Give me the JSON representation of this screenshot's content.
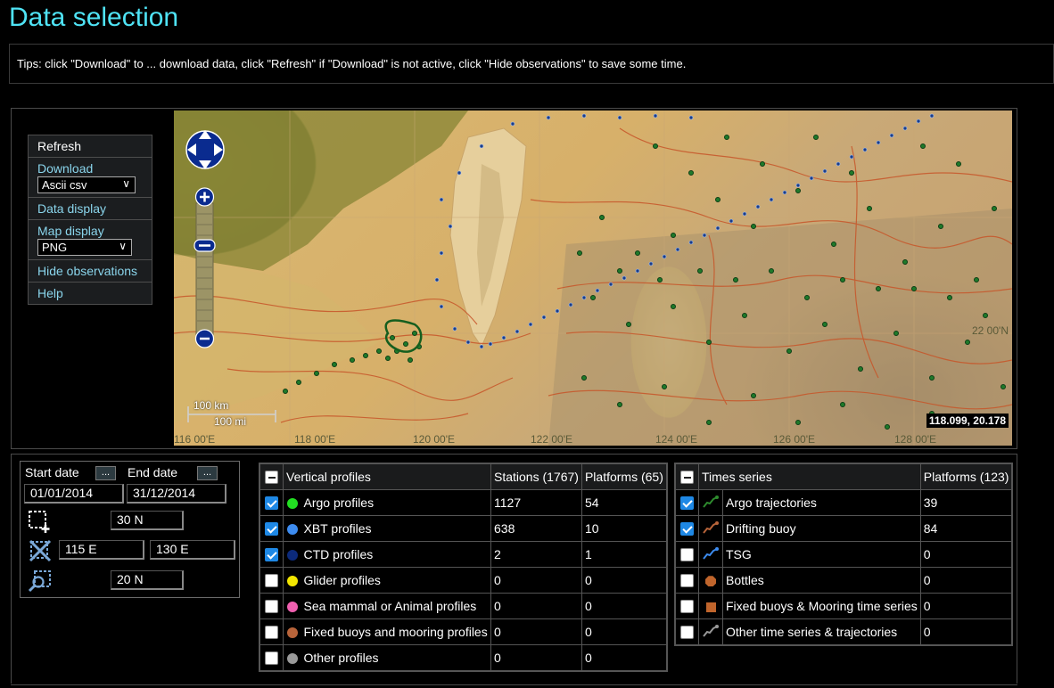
{
  "page": {
    "title": "Data selection"
  },
  "tips": {
    "text": "Tips: click \"Download\" to ... download data, click \"Refresh\" if \"Download\" is not active, click \"Hide observations\" to save some time."
  },
  "menu": {
    "refresh": "Refresh",
    "download": "Download",
    "download_format": "Ascii csv",
    "data_display": "Data display",
    "map_display": "Map display",
    "map_format": "PNG",
    "hide_observations": "Hide observations",
    "help": "Help"
  },
  "map": {
    "coordinates_readout": "118.099, 20.178",
    "scale_km": "100 km",
    "scale_mi": "100 mi",
    "lon_labels": [
      "116 00'E",
      "118 00'E",
      "120 00'E",
      "122 00'E",
      "124 00'E",
      "126 00'E",
      "128 00'E"
    ],
    "lat_label": "22 00'N"
  },
  "filters": {
    "start_date_label": "Start date",
    "end_date_label": "End date",
    "start_date": "01/01/2014",
    "end_date": "31/12/2014",
    "browse_label": "...",
    "north": "30 N",
    "west": "115 E",
    "east": "130 E",
    "south": "20 N"
  },
  "vertical_profiles": {
    "header": "Vertical profiles",
    "stations_header": "Stations (1767)",
    "platforms_header": "Platforms (65)",
    "rows": [
      {
        "label": "Argo profiles",
        "stations": "1127",
        "platforms": "54",
        "checked": true,
        "color": "#22e022"
      },
      {
        "label": "XBT profiles",
        "stations": "638",
        "platforms": "10",
        "checked": true,
        "color": "#3d8cf0"
      },
      {
        "label": "CTD profiles",
        "stations": "2",
        "platforms": "1",
        "checked": true,
        "color": "#0c2a7a"
      },
      {
        "label": "Glider profiles",
        "stations": "0",
        "platforms": "0",
        "checked": false,
        "color": "#f2e600"
      },
      {
        "label": "Sea mammal or Animal profiles",
        "stations": "0",
        "platforms": "0",
        "checked": false,
        "color": "#f060b0"
      },
      {
        "label": "Fixed buoys and mooring profiles",
        "stations": "0",
        "platforms": "0",
        "checked": false,
        "color": "#b8643a"
      },
      {
        "label": "Other profiles",
        "stations": "0",
        "platforms": "0",
        "checked": false,
        "color": "#9a9a9a"
      }
    ]
  },
  "time_series": {
    "header": "Times series",
    "platforms_header": "Platforms (123)",
    "rows": [
      {
        "label": "Argo trajectories",
        "platforms": "39",
        "checked": true,
        "color": "#2e8b2e"
      },
      {
        "label": "Drifting buoy",
        "platforms": "84",
        "checked": true,
        "color": "#b8643a"
      },
      {
        "label": "TSG",
        "platforms": "0",
        "checked": false,
        "color": "#3d8cf0"
      },
      {
        "label": "Bottles",
        "platforms": "0",
        "checked": false,
        "color": "#c0652c"
      },
      {
        "label": "Fixed buoys & Mooring time series",
        "platforms": "0",
        "checked": false,
        "color": "#c0652c"
      },
      {
        "label": "Other time series & trajectories",
        "platforms": "0",
        "checked": false,
        "color": "#9a9a9a"
      }
    ]
  }
}
